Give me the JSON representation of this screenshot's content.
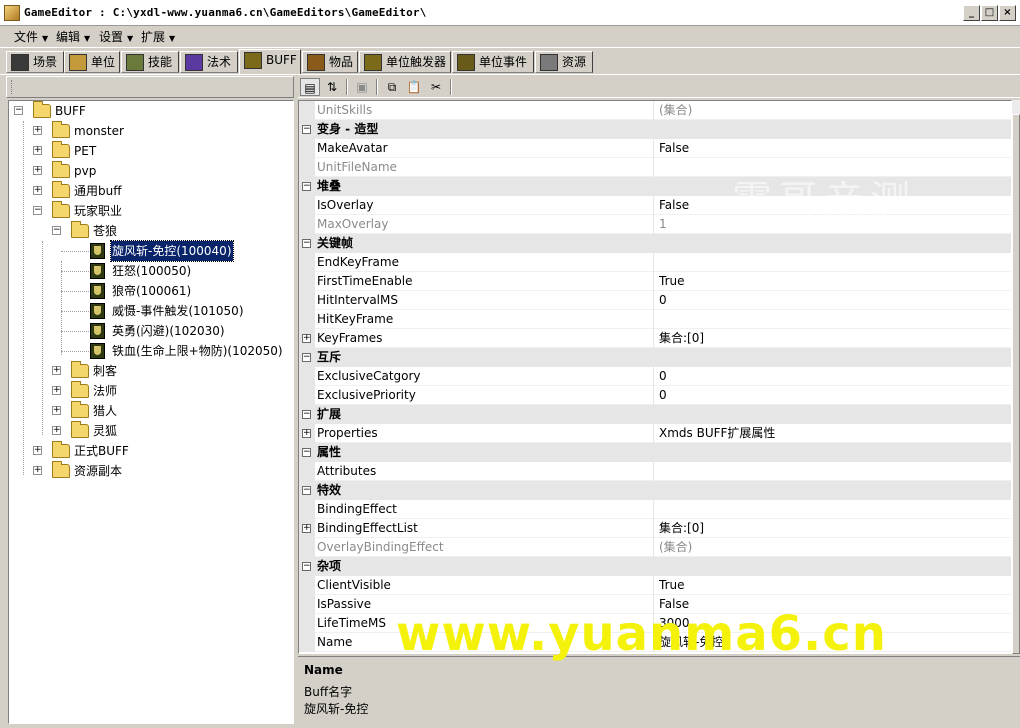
{
  "window": {
    "title": "GameEditor : C:\\yxdl-www.yuanma6.cn\\GameEditors\\GameEditor\\",
    "min": "_",
    "max": "□",
    "close": "×"
  },
  "menu": [
    {
      "label": "文件"
    },
    {
      "label": "编辑"
    },
    {
      "label": "设置"
    },
    {
      "label": "扩展"
    }
  ],
  "tabs": [
    {
      "label": "场景",
      "color": "#3a3a3a"
    },
    {
      "label": "单位",
      "color": "#c29a3a"
    },
    {
      "label": "技能",
      "color": "#6a7a3a"
    },
    {
      "label": "法术",
      "color": "#5a3aa0"
    },
    {
      "label": "BUFF",
      "color": "#7a6a1a"
    },
    {
      "label": "物品",
      "color": "#8a5a1a"
    },
    {
      "label": "单位触发器",
      "color": "#7a6a1a"
    },
    {
      "label": "单位事件",
      "color": "#6a5a1a"
    },
    {
      "label": "资源",
      "color": "#7a7a7a"
    }
  ],
  "tree": {
    "root": "BUFF",
    "nodes": [
      {
        "label": "monster"
      },
      {
        "label": "PET"
      },
      {
        "label": "pvp"
      },
      {
        "label": "通用buff"
      },
      {
        "label": "玩家职业"
      },
      {
        "label": "苍狼"
      },
      {
        "label": "旋风斩-免控(100040)"
      },
      {
        "label": "狂怒(100050)"
      },
      {
        "label": "狼帝(100061)"
      },
      {
        "label": "威慑-事件触发(101050)"
      },
      {
        "label": "英勇(闪避)(102030)"
      },
      {
        "label": "铁血(生命上限+物防)(102050)"
      },
      {
        "label": "刺客"
      },
      {
        "label": "法师"
      },
      {
        "label": "猎人"
      },
      {
        "label": "灵狐"
      },
      {
        "label": "正式BUFF"
      },
      {
        "label": "资源副本"
      }
    ]
  },
  "toolbar_icons": [
    "categorized-icon",
    "sort-az-icon",
    "property-pages-icon",
    "copy-icon",
    "paste-icon",
    "cut-icon"
  ],
  "properties": [
    {
      "name": "UnitSkills",
      "value": "(集合)"
    },
    {
      "category": "变身 - 造型"
    },
    {
      "name": "MakeAvatar",
      "value": "False"
    },
    {
      "name": "UnitFileName",
      "value": ""
    },
    {
      "category": "堆叠"
    },
    {
      "name": "IsOverlay",
      "value": "False"
    },
    {
      "name": "MaxOverlay",
      "value": "1"
    },
    {
      "category": "关键帧"
    },
    {
      "name": "EndKeyFrame",
      "value": ""
    },
    {
      "name": "FirstTimeEnable",
      "value": "True"
    },
    {
      "name": "HitIntervalMS",
      "value": "0"
    },
    {
      "name": "HitKeyFrame",
      "value": ""
    },
    {
      "name": "KeyFrames",
      "value": "集合:[0]"
    },
    {
      "category": "互斥"
    },
    {
      "name": "ExclusiveCatgory",
      "value": "0"
    },
    {
      "name": "ExclusivePriority",
      "value": "0"
    },
    {
      "category": "扩展"
    },
    {
      "name": "Properties",
      "value": "Xmds BUFF扩展属性"
    },
    {
      "category": "属性"
    },
    {
      "name": "Attributes",
      "value": ""
    },
    {
      "category": "特效"
    },
    {
      "name": "BindingEffect",
      "value": ""
    },
    {
      "name": "BindingEffectList",
      "value": "集合:[0]"
    },
    {
      "name": "OverlayBindingEffect",
      "value": "(集合)"
    },
    {
      "category": "杂项"
    },
    {
      "name": "ClientVisible",
      "value": "True"
    },
    {
      "name": "IsPassive",
      "value": "False"
    },
    {
      "name": "LifeTimeMS",
      "value": "3000"
    },
    {
      "name": "Name",
      "value": "旋风斩-免控"
    }
  ],
  "help": {
    "title": "Name",
    "description": "Buff名字",
    "value": "旋风斩-免控"
  },
  "watermarks": {
    "top": "霸哥亲测",
    "bottom": "www.yuanma6.cn"
  }
}
